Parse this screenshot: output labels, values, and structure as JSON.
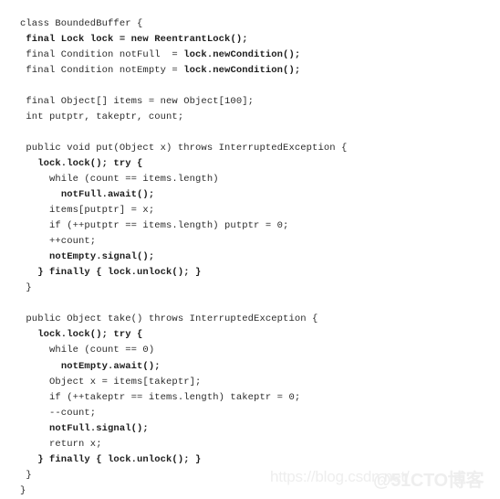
{
  "figure": {
    "language": "java",
    "class_name": "BoundedBuffer",
    "background_color": "#ffffff",
    "text_color": "#2b2b2b",
    "watermark_color": "#eeeeee"
  },
  "watermarks": {
    "url": "https://blog.csdn.net/",
    "brand": "@51CTO博客"
  },
  "code": {
    "lines": [
      {
        "id": "l1",
        "segments": [
          {
            "text": "class BoundedBuffer {",
            "bold": false
          }
        ]
      },
      {
        "id": "l2",
        "segments": [
          {
            "text": " ",
            "bold": false
          },
          {
            "text": "final Lock lock = new ReentrantLock();",
            "bold": true
          }
        ]
      },
      {
        "id": "l3",
        "segments": [
          {
            "text": " final Condition notFull  = ",
            "bold": false
          },
          {
            "text": "lock.newCondition();",
            "bold": true
          }
        ]
      },
      {
        "id": "l4",
        "segments": [
          {
            "text": " final Condition notEmpty = ",
            "bold": false
          },
          {
            "text": "lock.newCondition();",
            "bold": true
          }
        ]
      },
      {
        "id": "l5",
        "segments": [
          {
            "text": "",
            "bold": false
          }
        ]
      },
      {
        "id": "l6",
        "segments": [
          {
            "text": " final Object[] items = new Object[100];",
            "bold": false
          }
        ]
      },
      {
        "id": "l7",
        "segments": [
          {
            "text": " int putptr, takeptr, count;",
            "bold": false
          }
        ]
      },
      {
        "id": "l8",
        "segments": [
          {
            "text": "",
            "bold": false
          }
        ]
      },
      {
        "id": "l9",
        "segments": [
          {
            "text": " public void put(Object x) throws InterruptedException {",
            "bold": false
          }
        ]
      },
      {
        "id": "l10",
        "segments": [
          {
            "text": "   ",
            "bold": false
          },
          {
            "text": "lock.lock(); try {",
            "bold": true
          }
        ]
      },
      {
        "id": "l11",
        "segments": [
          {
            "text": "     while (count == items.length)",
            "bold": false
          }
        ]
      },
      {
        "id": "l12",
        "segments": [
          {
            "text": "       ",
            "bold": false
          },
          {
            "text": "notFull.await();",
            "bold": true
          }
        ]
      },
      {
        "id": "l13",
        "segments": [
          {
            "text": "     items[putptr] = x;",
            "bold": false
          }
        ]
      },
      {
        "id": "l14",
        "segments": [
          {
            "text": "     if (++putptr == items.length) putptr = 0;",
            "bold": false
          }
        ]
      },
      {
        "id": "l15",
        "segments": [
          {
            "text": "     ++count;",
            "bold": false
          }
        ]
      },
      {
        "id": "l16",
        "segments": [
          {
            "text": "     ",
            "bold": false
          },
          {
            "text": "notEmpty.signal();",
            "bold": true
          }
        ]
      },
      {
        "id": "l17",
        "segments": [
          {
            "text": "   ",
            "bold": false
          },
          {
            "text": "} finally { lock.unlock(); }",
            "bold": true
          }
        ]
      },
      {
        "id": "l18",
        "segments": [
          {
            "text": " }",
            "bold": false
          }
        ]
      },
      {
        "id": "l19",
        "segments": [
          {
            "text": "",
            "bold": false
          }
        ]
      },
      {
        "id": "l20",
        "segments": [
          {
            "text": " public Object take() throws InterruptedException {",
            "bold": false
          }
        ]
      },
      {
        "id": "l21",
        "segments": [
          {
            "text": "   ",
            "bold": false
          },
          {
            "text": "lock.lock(); try {",
            "bold": true
          }
        ]
      },
      {
        "id": "l22",
        "segments": [
          {
            "text": "     while (count == 0)",
            "bold": false
          }
        ]
      },
      {
        "id": "l23",
        "segments": [
          {
            "text": "       ",
            "bold": false
          },
          {
            "text": "notEmpty.await();",
            "bold": true
          }
        ]
      },
      {
        "id": "l24",
        "segments": [
          {
            "text": "     Object x = items[takeptr];",
            "bold": false
          }
        ]
      },
      {
        "id": "l25",
        "segments": [
          {
            "text": "     if (++takeptr == items.length) takeptr = 0;",
            "bold": false
          }
        ]
      },
      {
        "id": "l26",
        "segments": [
          {
            "text": "     --count;",
            "bold": false
          }
        ]
      },
      {
        "id": "l27",
        "segments": [
          {
            "text": "     ",
            "bold": false
          },
          {
            "text": "notFull.signal();",
            "bold": true
          }
        ]
      },
      {
        "id": "l28",
        "segments": [
          {
            "text": "     return x;",
            "bold": false
          }
        ]
      },
      {
        "id": "l29",
        "segments": [
          {
            "text": "   ",
            "bold": false
          },
          {
            "text": "} finally { lock.unlock(); }",
            "bold": true
          }
        ]
      },
      {
        "id": "l30",
        "segments": [
          {
            "text": " }",
            "bold": false
          }
        ]
      },
      {
        "id": "l31",
        "segments": [
          {
            "text": "}",
            "bold": false
          }
        ]
      }
    ]
  }
}
